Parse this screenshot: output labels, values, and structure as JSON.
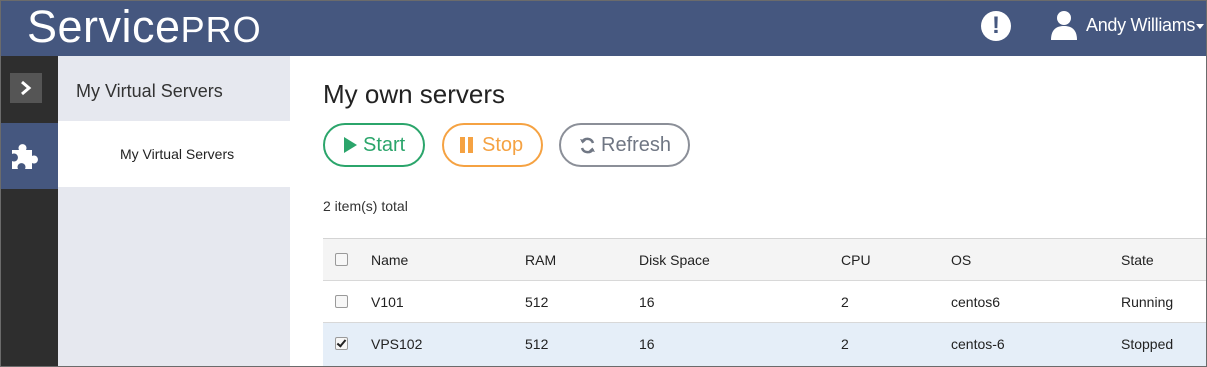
{
  "header": {
    "brand_main": "Service",
    "brand_sub": "PRO",
    "user_name": "Andy Williams"
  },
  "sidebar": {
    "title": "My Virtual Servers",
    "selected_item": "My Virtual Servers"
  },
  "main": {
    "title": "My own servers",
    "buttons": {
      "start": "Start",
      "stop": "Stop",
      "refresh": "Refresh"
    },
    "total": "2 item(s) total"
  },
  "table": {
    "columns": [
      "Name",
      "RAM",
      "Disk Space",
      "CPU",
      "OS",
      "State"
    ],
    "rows": [
      {
        "name": "V101",
        "ram": "512",
        "disk": "16",
        "cpu": "2",
        "os": "centos6",
        "state": "Running",
        "checked": false
      },
      {
        "name": "VPS102",
        "ram": "512",
        "disk": "16",
        "cpu": "2",
        "os": "centos-6",
        "state": "Stopped",
        "checked": true
      }
    ]
  },
  "colors": {
    "header": "#45577f",
    "start": "#2ba56b",
    "stop": "#f5a242",
    "refresh": "#8b8f98",
    "selected_row": "#e5eef8"
  },
  "icons": [
    "alert-icon",
    "user-icon",
    "chevron-right-icon",
    "puzzle-icon",
    "play-icon",
    "pause-icon",
    "refresh-icon",
    "checkbox"
  ]
}
